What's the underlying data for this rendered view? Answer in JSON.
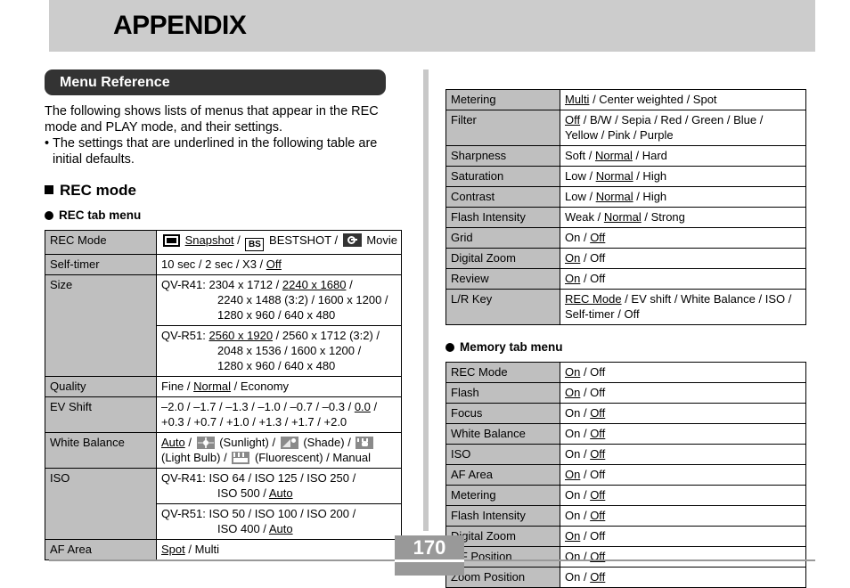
{
  "banner": {
    "title": "APPENDIX"
  },
  "section": {
    "pill_label": "Menu Reference",
    "intro_line1": "The following shows lists of menus that appear in the REC",
    "intro_line2": "mode and PLAY mode, and their settings.",
    "bullet_line1": "The settings that are underlined in the following table are",
    "bullet_line2": "initial defaults.",
    "bullet_mark": "•"
  },
  "headings": {
    "rec_mode": "REC mode",
    "rec_tab_menu": "REC tab menu",
    "memory_tab_menu": "Memory tab menu"
  },
  "rec_tab_table": {
    "rows": [
      {
        "label": "REC Mode",
        "type": "icons",
        "parts": [
          {
            "icon": "snapshot-icon",
            "text": "Snapshot",
            "underline": true
          },
          {
            "sep": " / "
          },
          {
            "icon": "bestshot-icon",
            "icon_text": "BS",
            "text": "BESTSHOT",
            "underline": false
          },
          {
            "sep": " / "
          },
          {
            "icon": "movie-icon",
            "text": "Movie",
            "underline": false
          }
        ]
      },
      {
        "label": "Self-timer",
        "type": "plain",
        "lines": [
          {
            "pre": "10 sec / 2 sec / X3 / ",
            "u": "Off",
            "post": ""
          }
        ]
      },
      {
        "label": "Size",
        "type": "models",
        "subrows": [
          {
            "lines": [
              {
                "model": "QV-R41:",
                "pre": " 2304 x 1712 / ",
                "u": "2240 x 1680",
                "post": " /"
              },
              {
                "cont": "2240 x 1488 (3:2) / 1600 x 1200 /"
              },
              {
                "cont": "1280 x 960 / 640 x 480"
              }
            ]
          },
          {
            "lines": [
              {
                "model": "QV-R51:",
                "pre": " ",
                "u": "2560 x 1920",
                "post": " / 2560 x 1712 (3:2) /"
              },
              {
                "cont": "2048 x 1536 / 1600 x 1200 /"
              },
              {
                "cont": "1280 x 960 / 640 x 480"
              }
            ]
          }
        ]
      },
      {
        "label": "Quality",
        "type": "plain",
        "lines": [
          {
            "pre": "Fine / ",
            "u": "Normal",
            "post": " / Economy"
          }
        ]
      },
      {
        "label": "EV Shift",
        "type": "plain",
        "lines": [
          {
            "pre": "–2.0 / –1.7 / –1.3 / –1.0 / –0.7 / –0.3 / ",
            "u": "0.0",
            "post": " /"
          },
          {
            "pre": "+0.3 / +0.7 / +1.0 / +1.3 / +1.7 / +2.0",
            "u": "",
            "post": ""
          }
        ]
      },
      {
        "label": "White Balance",
        "type": "wb",
        "line1_pre_u": "Auto",
        "line1_parts": [
          {
            "sep": " / "
          },
          {
            "icon": "sunlight-icon",
            "text": "(Sunlight)"
          },
          {
            "sep": " / "
          },
          {
            "icon": "shade-icon",
            "text": "(Shade)"
          },
          {
            "sep": " / "
          },
          {
            "icon": "lightbulb-icon",
            "text": ""
          }
        ],
        "line2_parts": [
          {
            "text": "(Light Bulb) / "
          },
          {
            "icon": "fluorescent-icon",
            "text": "(Fluorescent) / Manual"
          }
        ]
      },
      {
        "label": "ISO",
        "type": "models",
        "subrows": [
          {
            "lines": [
              {
                "model": "QV-R41:",
                "pre": "  ISO 64 / ISO 125 / ISO 250 /",
                "u": "",
                "post": ""
              },
              {
                "cont_u": "ISO 500 / ",
                "cont_uu": "Auto"
              }
            ]
          },
          {
            "lines": [
              {
                "model": "QV-R51:",
                "pre": "  ISO 50 / ISO 100 / ISO 200 /",
                "u": "",
                "post": ""
              },
              {
                "cont_u": "ISO 400 / ",
                "cont_uu": "Auto"
              }
            ]
          }
        ]
      },
      {
        "label": "AF Area",
        "type": "plain",
        "lines": [
          {
            "pre": "",
            "u": "Spot",
            "post": "  / Multi"
          }
        ]
      }
    ]
  },
  "rec_tab_table_right": {
    "rows": [
      {
        "label": "Metering",
        "lines": [
          {
            "pre": "",
            "u": "Multi",
            "post": " / Center weighted / Spot"
          }
        ]
      },
      {
        "label": "Filter",
        "lines": [
          {
            "pre": "",
            "u": "Off",
            "post": " / B/W / Sepia / Red / Green / Blue /"
          },
          {
            "pre": "Yellow / Pink / Purple",
            "u": "",
            "post": ""
          }
        ]
      },
      {
        "label": "Sharpness",
        "lines": [
          {
            "pre": "Soft / ",
            "u": "Normal",
            "post": " / Hard"
          }
        ]
      },
      {
        "label": "Saturation",
        "lines": [
          {
            "pre": "Low / ",
            "u": "Normal",
            "post": " / High"
          }
        ]
      },
      {
        "label": "Contrast",
        "lines": [
          {
            "pre": "Low / ",
            "u": "Normal",
            "post": " / High"
          }
        ]
      },
      {
        "label": "Flash Intensity",
        "lines": [
          {
            "pre": "Weak / ",
            "u": "Normal",
            "post": " / Strong"
          }
        ]
      },
      {
        "label": "Grid",
        "lines": [
          {
            "pre": "On / ",
            "u": "Off",
            "post": ""
          }
        ]
      },
      {
        "label": "Digital Zoom",
        "lines": [
          {
            "pre": "",
            "u": "On",
            "post": " / Off"
          }
        ]
      },
      {
        "label": "Review",
        "lines": [
          {
            "pre": "",
            "u": "On",
            "post": " / Off"
          }
        ]
      },
      {
        "label": "L/R Key",
        "lines": [
          {
            "pre": "",
            "u": "REC Mode",
            "post": " / EV shift / White Balance / ISO /"
          },
          {
            "pre": "Self-timer / Off",
            "u": "",
            "post": ""
          }
        ]
      }
    ]
  },
  "memory_table": {
    "rows": [
      {
        "label": "REC Mode",
        "pre": "",
        "u": "On",
        "post": " / Off"
      },
      {
        "label": "Flash",
        "pre": "",
        "u": "On",
        "post": " / Off"
      },
      {
        "label": "Focus",
        "pre": "On / ",
        "u": "Off",
        "post": ""
      },
      {
        "label": "White Balance",
        "pre": "On / ",
        "u": "Off",
        "post": ""
      },
      {
        "label": "ISO",
        "pre": "On / ",
        "u": "Off",
        "post": ""
      },
      {
        "label": "AF Area",
        "pre": "",
        "u": "On",
        "post": " / Off"
      },
      {
        "label": "Metering",
        "pre": "On / ",
        "u": "Off",
        "post": ""
      },
      {
        "label": "Flash Intensity",
        "pre": "On / ",
        "u": "Off",
        "post": ""
      },
      {
        "label": "Digital Zoom",
        "pre": "",
        "u": "On",
        "post": " / Off"
      },
      {
        "label": "MF Position",
        "pre": "On / ",
        "u": "Off",
        "post": ""
      },
      {
        "label": "Zoom Position",
        "pre": "On / ",
        "u": "Off",
        "post": ""
      }
    ]
  },
  "footer": {
    "page_number": "170"
  },
  "colors": {
    "banner_bg": "#cccccc",
    "pill_bg": "#333333",
    "table_label_bg": "#bfbfbf",
    "footer_gray": "#999999",
    "divider_gray": "#c8c8c8"
  }
}
